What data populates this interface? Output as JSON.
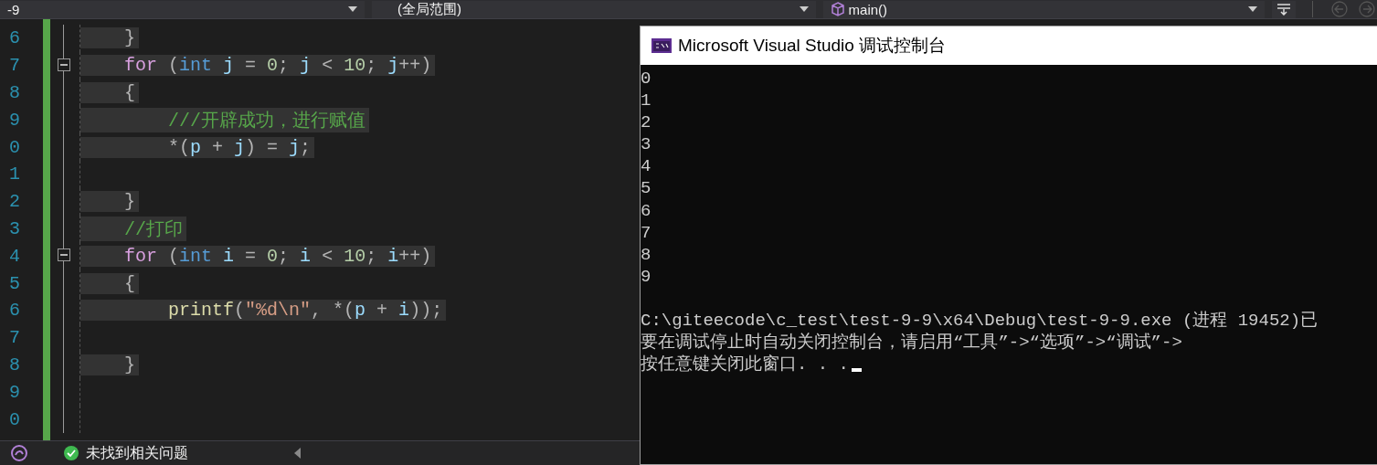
{
  "toolbar": {
    "dropdowns": [
      {
        "text": "-9",
        "kind": "plain"
      },
      {
        "text": "(全局范围)",
        "kind": "plain"
      },
      {
        "text": "main()",
        "kind": "function"
      }
    ]
  },
  "editor": {
    "lines": [
      {
        "number": "6",
        "fold": false,
        "tokens": [
          {
            "text": "    }",
            "kind": "punct"
          }
        ]
      },
      {
        "number": "7",
        "fold": true,
        "tokens": [
          {
            "text": "    for",
            "kind": "keyword"
          },
          {
            "text": " (",
            "kind": "punct"
          },
          {
            "text": "int",
            "kind": "type"
          },
          {
            "text": " j",
            "kind": "ident"
          },
          {
            "text": " = ",
            "kind": "punct"
          },
          {
            "text": "0",
            "kind": "number"
          },
          {
            "text": "; ",
            "kind": "punct"
          },
          {
            "text": "j",
            "kind": "ident"
          },
          {
            "text": " < ",
            "kind": "punct"
          },
          {
            "text": "10",
            "kind": "number"
          },
          {
            "text": "; ",
            "kind": "punct"
          },
          {
            "text": "j",
            "kind": "ident"
          },
          {
            "text": "++)",
            "kind": "punct"
          }
        ]
      },
      {
        "number": "8",
        "fold": false,
        "tokens": [
          {
            "text": "    {",
            "kind": "punct"
          }
        ]
      },
      {
        "number": "9",
        "fold": false,
        "tokens": [
          {
            "text": "        ///开辟成功，进行赋值",
            "kind": "comment"
          }
        ]
      },
      {
        "number": "0",
        "fold": false,
        "tokens": [
          {
            "text": "        *(",
            "kind": "punct"
          },
          {
            "text": "p",
            "kind": "ident"
          },
          {
            "text": " + ",
            "kind": "punct"
          },
          {
            "text": "j",
            "kind": "ident"
          },
          {
            "text": ") = ",
            "kind": "punct"
          },
          {
            "text": "j",
            "kind": "ident"
          },
          {
            "text": ";",
            "kind": "punct"
          }
        ]
      },
      {
        "number": "1",
        "fold": false
      },
      {
        "number": "2",
        "fold": false,
        "tokens": [
          {
            "text": "    }",
            "kind": "punct"
          }
        ]
      },
      {
        "number": "3",
        "fold": false,
        "tokens": [
          {
            "text": "    //打印",
            "kind": "comment"
          }
        ]
      },
      {
        "number": "4",
        "fold": true,
        "tokens": [
          {
            "text": "    for",
            "kind": "keyword"
          },
          {
            "text": " (",
            "kind": "punct"
          },
          {
            "text": "int",
            "kind": "type"
          },
          {
            "text": " i",
            "kind": "ident"
          },
          {
            "text": " = ",
            "kind": "punct"
          },
          {
            "text": "0",
            "kind": "number"
          },
          {
            "text": "; ",
            "kind": "punct"
          },
          {
            "text": "i",
            "kind": "ident"
          },
          {
            "text": " < ",
            "kind": "punct"
          },
          {
            "text": "10",
            "kind": "number"
          },
          {
            "text": "; ",
            "kind": "punct"
          },
          {
            "text": "i",
            "kind": "ident"
          },
          {
            "text": "++)",
            "kind": "punct"
          }
        ]
      },
      {
        "number": "5",
        "fold": false,
        "tokens": [
          {
            "text": "    {",
            "kind": "punct"
          }
        ]
      },
      {
        "number": "6",
        "fold": false,
        "tokens": [
          {
            "text": "        printf",
            "kind": "func"
          },
          {
            "text": "(",
            "kind": "punct"
          },
          {
            "text": "\"%d\\n\"",
            "kind": "string"
          },
          {
            "text": ", *(",
            "kind": "punct"
          },
          {
            "text": "p",
            "kind": "ident"
          },
          {
            "text": " + ",
            "kind": "punct"
          },
          {
            "text": "i",
            "kind": "ident"
          },
          {
            "text": "));",
            "kind": "punct"
          }
        ]
      },
      {
        "number": "7",
        "fold": false
      },
      {
        "number": "8",
        "fold": false,
        "tokens": [
          {
            "text": "    }",
            "kind": "punct"
          }
        ]
      },
      {
        "number": "9",
        "fold": false
      },
      {
        "number": "0",
        "fold": false
      }
    ]
  },
  "status_bar": {
    "message": "未找到相关问题"
  },
  "console": {
    "title": "Microsoft Visual Studio 调试控制台",
    "output": [
      "0",
      "1",
      "2",
      "3",
      "4",
      "5",
      "6",
      "7",
      "8",
      "9"
    ],
    "messages": [
      "C:\\giteecode\\c_test\\test-9-9\\x64\\Debug\\test-9-9.exe (进程 19452)已",
      "要在调试停止时自动关闭控制台，请启用“工具”->“选项”->“调试”->",
      "按任意键关闭此窗口. . ."
    ]
  }
}
